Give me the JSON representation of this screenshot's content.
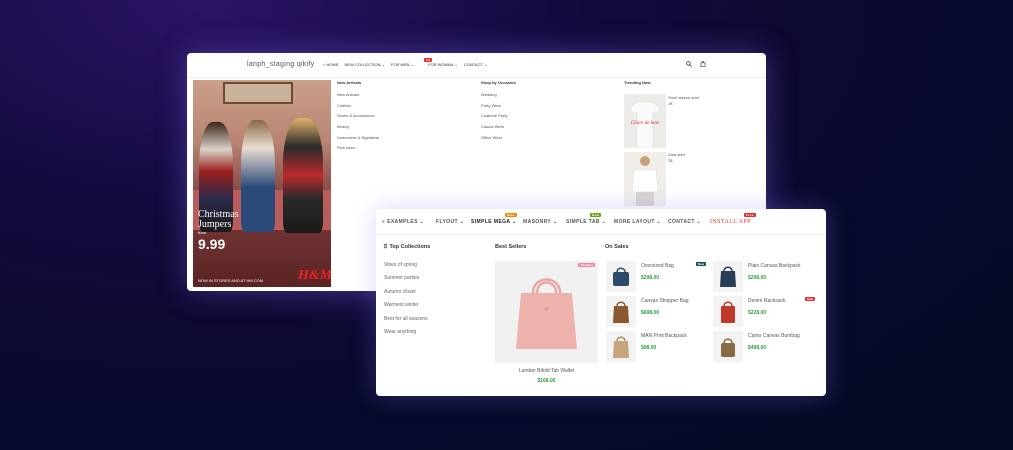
{
  "back_window": {
    "brand": "lanph_staging qikify",
    "nav": [
      "HOME",
      "NEW COLLECTION ⌄",
      "FOR MEN ⌄",
      "FOR WOMAN ⌄",
      "CONTACT ⌄"
    ],
    "nav_badge": "hot",
    "promo": {
      "line1": "Christmas",
      "line2": "Jumpers",
      "line3": "from",
      "price": "9.99",
      "footer": "NOW IN STORES AND AT HM.COM",
      "logo": "H&M"
    },
    "col1": {
      "title": "New Arrivals",
      "items": [
        "New Arrivals",
        "Clothes",
        "Shoes & Accessories",
        "Beauty",
        "Underwear & Nightwear",
        "Plus sizes"
      ]
    },
    "col2": {
      "title": "Shop by Occasion",
      "items": [
        "Wedding",
        "Party Wear",
        "Costume Party",
        "Casual Wear",
        "Office Wear"
      ]
    },
    "col3": {
      "title": "Trending Now",
      "items": [
        {
          "name": "Short sleeve shirt",
          "price": "1€"
        },
        {
          "name": "Zara shirt",
          "price": "2$"
        }
      ]
    },
    "tshirt_print": "Claire de lune"
  },
  "front_window": {
    "nav": [
      {
        "label": "EXAMPLES ⌄",
        "icon": "menu-icon"
      },
      {
        "label": "FLYOUT ⌄",
        "tag": "Hot",
        "tag_color": "#f08c00"
      },
      {
        "label": "SIMPLE MEGA ⌄",
        "tag": "Sale",
        "tag_color": "#f08c00"
      },
      {
        "label": "MASONRY ⌄"
      },
      {
        "label": "SIMPLE TAB ⌄",
        "tag": "New",
        "tag_color": "#66a80f"
      },
      {
        "label": "MORE LAYOUT ⌄"
      },
      {
        "label": "CONTACT ⌄"
      },
      {
        "label": "INSTALL APP",
        "tag": "Free",
        "tag_color": "#e03131"
      }
    ],
    "top_collections": {
      "title": "Top Collections",
      "items": [
        "Vibes of spring",
        "Summer parties",
        "Autumn closet",
        "Warmest winter",
        "Best for all seasons",
        "Wear anything"
      ]
    },
    "best_sellers": {
      "title": "Best Sellers",
      "badge": "Trending",
      "product": {
        "name": "Lumber Bifold Tab Wallet",
        "price": "$168.00"
      }
    },
    "on_sales": {
      "title": "On Sales",
      "products": [
        {
          "name": "Oversized Bag",
          "price": "$298.00",
          "badge": "New",
          "color": "#2d4a6b"
        },
        {
          "name": "Plain Canvas Backpack",
          "price": "$298.00",
          "color": "#2b3c57"
        },
        {
          "name": "Canvas Shopper Bag",
          "price": "$698.00",
          "color": "#8a5a2e"
        },
        {
          "name": "Denim Racksack",
          "price": "$228.00",
          "badge": "Sale",
          "color": "#c0392b"
        },
        {
          "name": "MAN Print Backpack",
          "price": "$98.00",
          "color": "#c7a47c"
        },
        {
          "name": "Camo Canvas Bumbag",
          "price": "$498.00",
          "color": "#8a6a42"
        }
      ]
    }
  }
}
